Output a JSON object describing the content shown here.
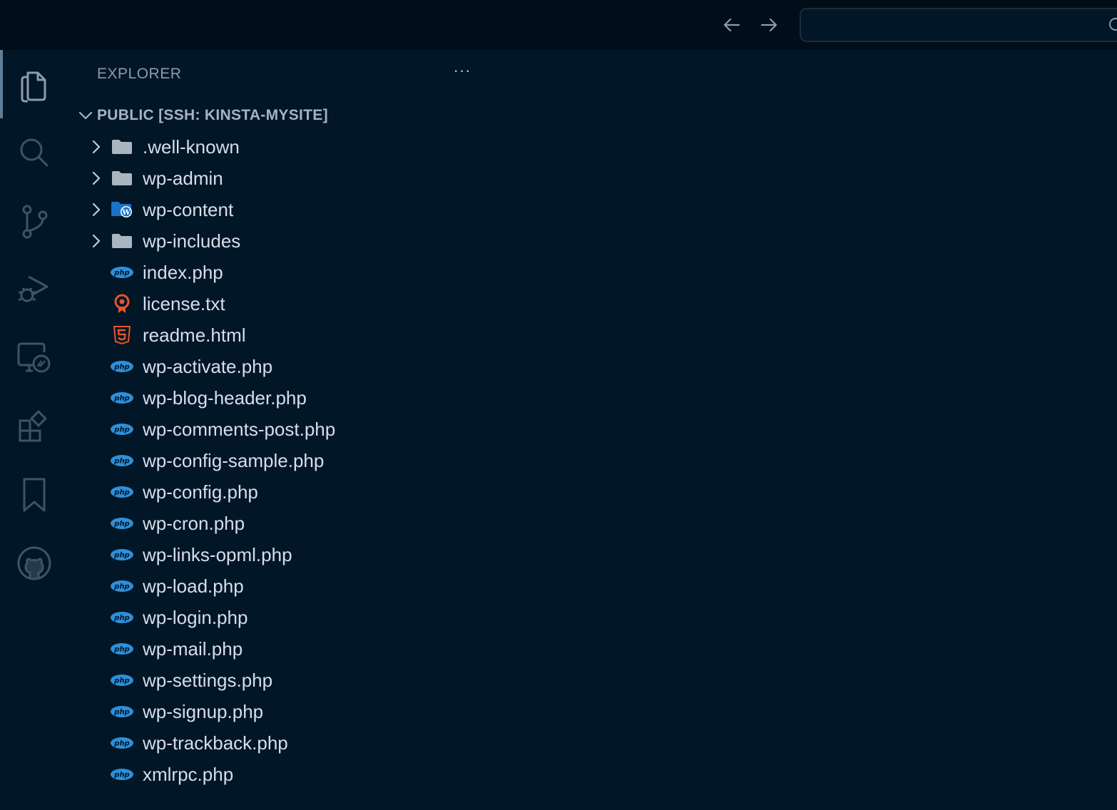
{
  "colors": {
    "background": "#011627",
    "titlebar": "#010e1a",
    "text": "#d6deeb",
    "muted": "#8b9cab",
    "php": "#2e8fd8",
    "accent_orange": "#e8552a",
    "folder": "#a9b6c2",
    "wp_blue": "#1a73c7"
  },
  "titlebar": {
    "back_icon": "arrow-left-icon",
    "forward_icon": "arrow-right-icon",
    "search_icon": "search-icon"
  },
  "activitybar": {
    "items": [
      {
        "name": "explorer",
        "icon": "files-icon",
        "active": true
      },
      {
        "name": "search",
        "icon": "search-icon"
      },
      {
        "name": "source-control",
        "icon": "source-control-icon"
      },
      {
        "name": "run-debug",
        "icon": "run-debug-icon"
      },
      {
        "name": "remote-explorer",
        "icon": "remote-explorer-icon"
      },
      {
        "name": "extensions",
        "icon": "extensions-icon"
      },
      {
        "name": "bookmarks",
        "icon": "bookmark-icon"
      },
      {
        "name": "github",
        "icon": "github-icon"
      }
    ]
  },
  "sidebar": {
    "title": "EXPLORER",
    "more": "···",
    "root": {
      "label": "PUBLIC [SSH: KINSTA-MYSITE]",
      "expanded": true
    },
    "items": [
      {
        "label": ".well-known",
        "type": "folder",
        "icon": "folder-icon"
      },
      {
        "label": "wp-admin",
        "type": "folder",
        "icon": "folder-icon"
      },
      {
        "label": "wp-content",
        "type": "folder",
        "icon": "wordpress-folder-icon"
      },
      {
        "label": "wp-includes",
        "type": "folder",
        "icon": "folder-icon"
      },
      {
        "label": "index.php",
        "type": "php",
        "icon": "php-icon"
      },
      {
        "label": "license.txt",
        "type": "license",
        "icon": "license-icon"
      },
      {
        "label": "readme.html",
        "type": "html",
        "icon": "html5-icon"
      },
      {
        "label": "wp-activate.php",
        "type": "php",
        "icon": "php-icon"
      },
      {
        "label": "wp-blog-header.php",
        "type": "php",
        "icon": "php-icon"
      },
      {
        "label": "wp-comments-post.php",
        "type": "php",
        "icon": "php-icon"
      },
      {
        "label": "wp-config-sample.php",
        "type": "php",
        "icon": "php-icon"
      },
      {
        "label": "wp-config.php",
        "type": "php",
        "icon": "php-icon"
      },
      {
        "label": "wp-cron.php",
        "type": "php",
        "icon": "php-icon"
      },
      {
        "label": "wp-links-opml.php",
        "type": "php",
        "icon": "php-icon"
      },
      {
        "label": "wp-load.php",
        "type": "php",
        "icon": "php-icon"
      },
      {
        "label": "wp-login.php",
        "type": "php",
        "icon": "php-icon"
      },
      {
        "label": "wp-mail.php",
        "type": "php",
        "icon": "php-icon"
      },
      {
        "label": "wp-settings.php",
        "type": "php",
        "icon": "php-icon"
      },
      {
        "label": "wp-signup.php",
        "type": "php",
        "icon": "php-icon"
      },
      {
        "label": "wp-trackback.php",
        "type": "php",
        "icon": "php-icon"
      },
      {
        "label": "xmlrpc.php",
        "type": "php",
        "icon": "php-icon"
      }
    ]
  }
}
